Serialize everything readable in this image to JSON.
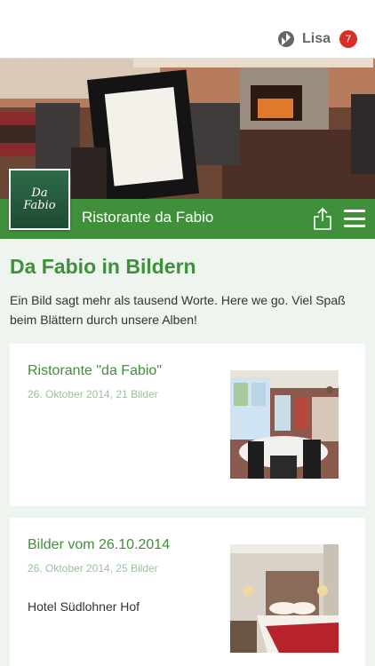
{
  "header": {
    "user_name": "Lisa",
    "notification_count": "7"
  },
  "page": {
    "restaurant_name": "Ristorante da Fabio",
    "logo_line1": "Da",
    "logo_line2": "Fabio",
    "heading": "Da Fabio in Bildern",
    "intro": "Ein Bild sagt mehr als tausend Worte. Here we go. Viel Spaß beim Blättern durch unsere Alben!"
  },
  "albums": [
    {
      "title": "Ristorante \"da Fabio\"",
      "meta": "26. Oktober 2014, 21 Bilder"
    },
    {
      "title": "Bilder vom 26.10.2014",
      "meta": "26. Oktober 2014, 25 Bilder",
      "description": "Hotel Südlohner Hof"
    }
  ],
  "colors": {
    "brand_green": "#3f8f3b",
    "badge_red": "#d63028",
    "meta_green": "#9bc29a"
  },
  "icons": [
    "user-icon",
    "share-icon",
    "menu-icon"
  ]
}
